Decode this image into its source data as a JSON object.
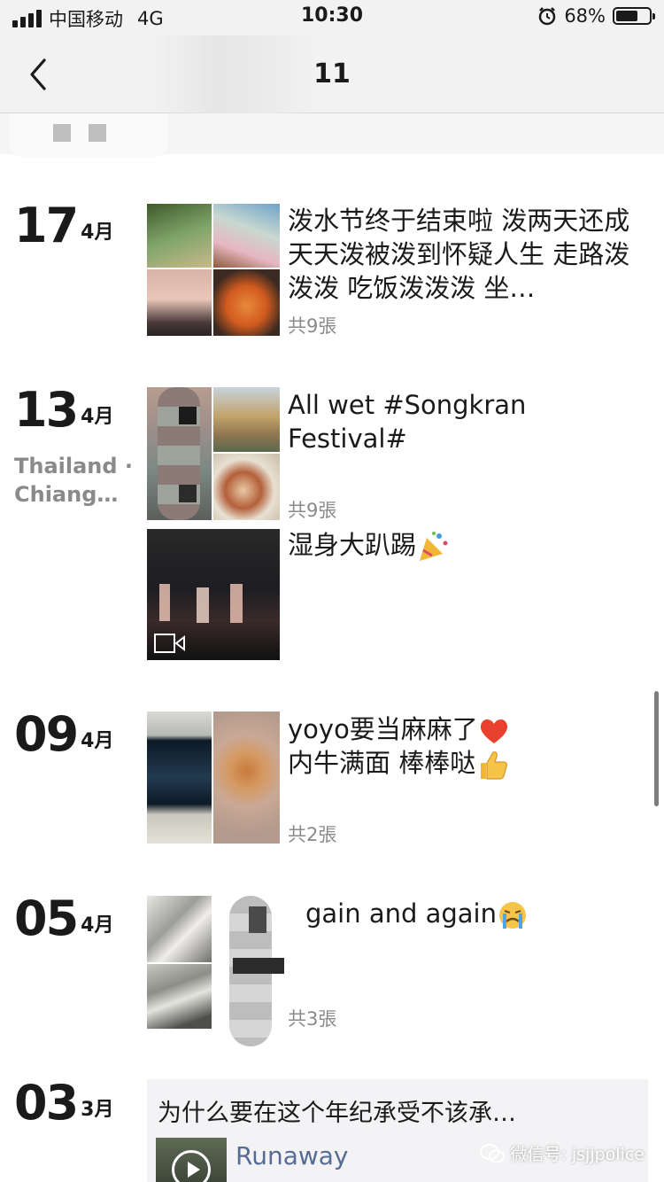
{
  "status_bar": {
    "carrier": "中国移动",
    "network": "4G",
    "time": "10:30",
    "battery": "68%",
    "battery_level": 0.68
  },
  "nav": {
    "title": "11",
    "back_icon": "chevron-left-icon"
  },
  "entries": [
    {
      "day": "17",
      "month": "4月",
      "text": "泼水节终于结束啦 泼两天还成 天天泼被泼到怀疑人生 走路泼泼泼 吃饭泼泼泼 坐…",
      "count": "共9張"
    },
    {
      "day": "13",
      "month": "4月",
      "location": "Thailand · Chiang…",
      "text": "All wet #Songkran Festival#",
      "count": "共9張",
      "second_text": "湿身大趴踢"
    },
    {
      "day": "09",
      "month": "4月",
      "text_line1": "yoyo要当麻麻了",
      "text_line2": "内牛满面 棒棒哒",
      "count": "共2張"
    },
    {
      "day": "05",
      "month": "4月",
      "text": "gain and again",
      "count": "共3張"
    },
    {
      "day": "03",
      "month": "3月"
    }
  ],
  "share": {
    "title": "为什么要在这个年纪承受不该承…",
    "name": "Runaway"
  },
  "watermark": "微信号: jsjjpolice",
  "colors": {
    "bar_bg": "#f2f2f2",
    "link": "#576b95",
    "muted": "#8a8a8a"
  }
}
